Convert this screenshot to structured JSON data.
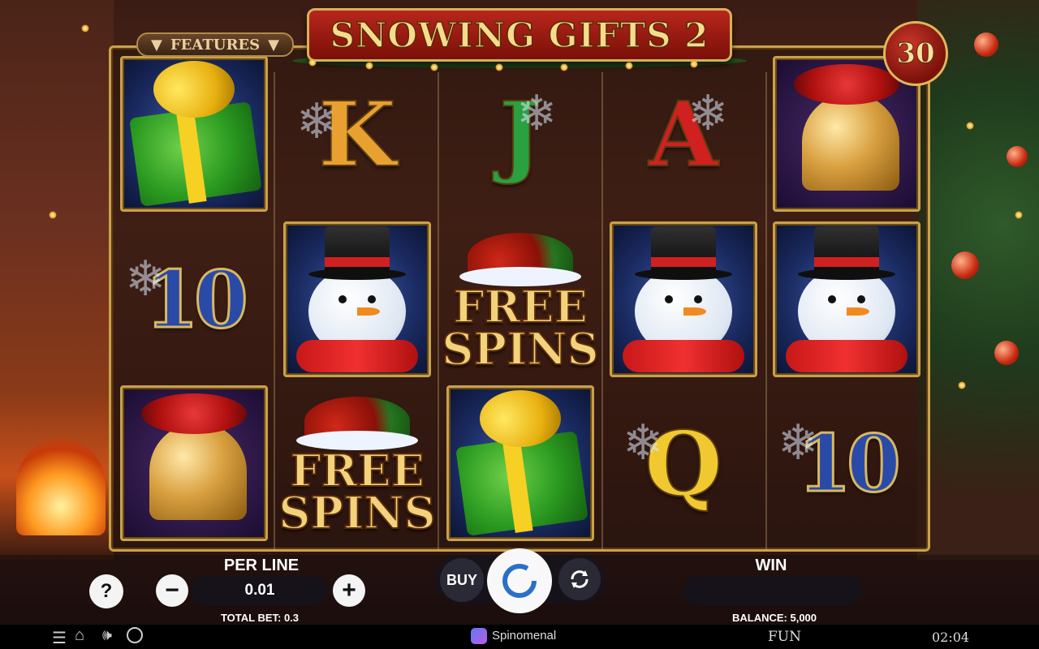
{
  "game": {
    "title": "SNOWING GIFTS 2",
    "features_label": "FEATURES",
    "lines": "30"
  },
  "reels": [
    [
      "gift",
      "10",
      "bell"
    ],
    [
      "K",
      "snowman",
      "free-spins"
    ],
    [
      "J",
      "free-spins",
      "gift"
    ],
    [
      "A",
      "snowman",
      "Q"
    ],
    [
      "bell",
      "snowman",
      "10"
    ]
  ],
  "symbols": {
    "free_spins_text_1": "FREE",
    "free_spins_text_2": "SPINS",
    "K": "K",
    "J": "J",
    "A": "A",
    "Q": "Q",
    "ten": "10"
  },
  "controls": {
    "help_label": "?",
    "per_line_label": "PER LINE",
    "per_line_value": "0.01",
    "minus_label": "−",
    "plus_label": "+",
    "total_bet_label": "TOTAL BET: 0.3",
    "buy_label": "BUY",
    "win_label": "WIN",
    "win_value": "",
    "balance_label": "BALANCE: 5,000"
  },
  "footer": {
    "brand": "Spinomenal",
    "mode": "FUN",
    "time": "02:04"
  },
  "colors": {
    "gold": "#c9a248",
    "title_red": "#b8261c",
    "letter_K": "#e8a030",
    "letter_J": "#2aa040",
    "letter_A": "#d02020",
    "letter_Q": "#f0c830"
  }
}
